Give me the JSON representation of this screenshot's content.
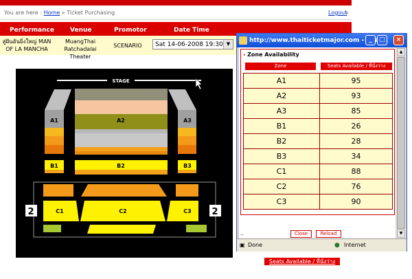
{
  "breadcrumb": {
    "prefix": "You are here :",
    "home": "Home",
    "sep": "»",
    "current": "Ticket Purchasing"
  },
  "logout": "Logout",
  "logout_arrow": "»",
  "headers": {
    "performance": "Performance",
    "venue": "Venue",
    "promotor": "Promotor",
    "datetime": "Date Time"
  },
  "info": {
    "performance_l1": "สู่ฝันอันยิ่งใหญ่ MAN",
    "performance_l2": "OF LA MANCHA",
    "venue_l1": "MuangThai",
    "venue_l2": "Ratchadalai Theater",
    "promotor": "SCENARIO",
    "datetime": "Sat 14-06-2008 19:30"
  },
  "map": {
    "stage": "STAGE",
    "zones": {
      "a1": "A1",
      "a2": "A2",
      "a3": "A3",
      "b1": "B1",
      "b2": "B2",
      "b3": "B3",
      "c1": "C1",
      "c2": "C2",
      "c3": "C3"
    },
    "side_left": "2",
    "side_right": "2"
  },
  "seats_button": "Seats Available / ที่นั่งว่าง",
  "popup": {
    "title": "http://www.thaiticketmajor.com - Thai...",
    "zone_title": "Zone Availability",
    "col_zone": "Zone",
    "col_seats": "Seats Available / ที่นั่งว่าง",
    "rows": [
      {
        "zone": "A1",
        "seats": "95"
      },
      {
        "zone": "A2",
        "seats": "93"
      },
      {
        "zone": "A3",
        "seats": "85"
      },
      {
        "zone": "B1",
        "seats": "26"
      },
      {
        "zone": "B2",
        "seats": "28"
      },
      {
        "zone": "B3",
        "seats": "34"
      },
      {
        "zone": "C1",
        "seats": "88"
      },
      {
        "zone": "C2",
        "seats": "76"
      },
      {
        "zone": "C3",
        "seats": "90"
      }
    ],
    "close": "Close",
    "reload": "Reload",
    "dots": "..",
    "status_done": "Done",
    "status_zone": "Internet"
  },
  "colors": {
    "brand_red": "#e00000",
    "cream": "#fffbcc",
    "title_blue": "#0f4fd6"
  }
}
